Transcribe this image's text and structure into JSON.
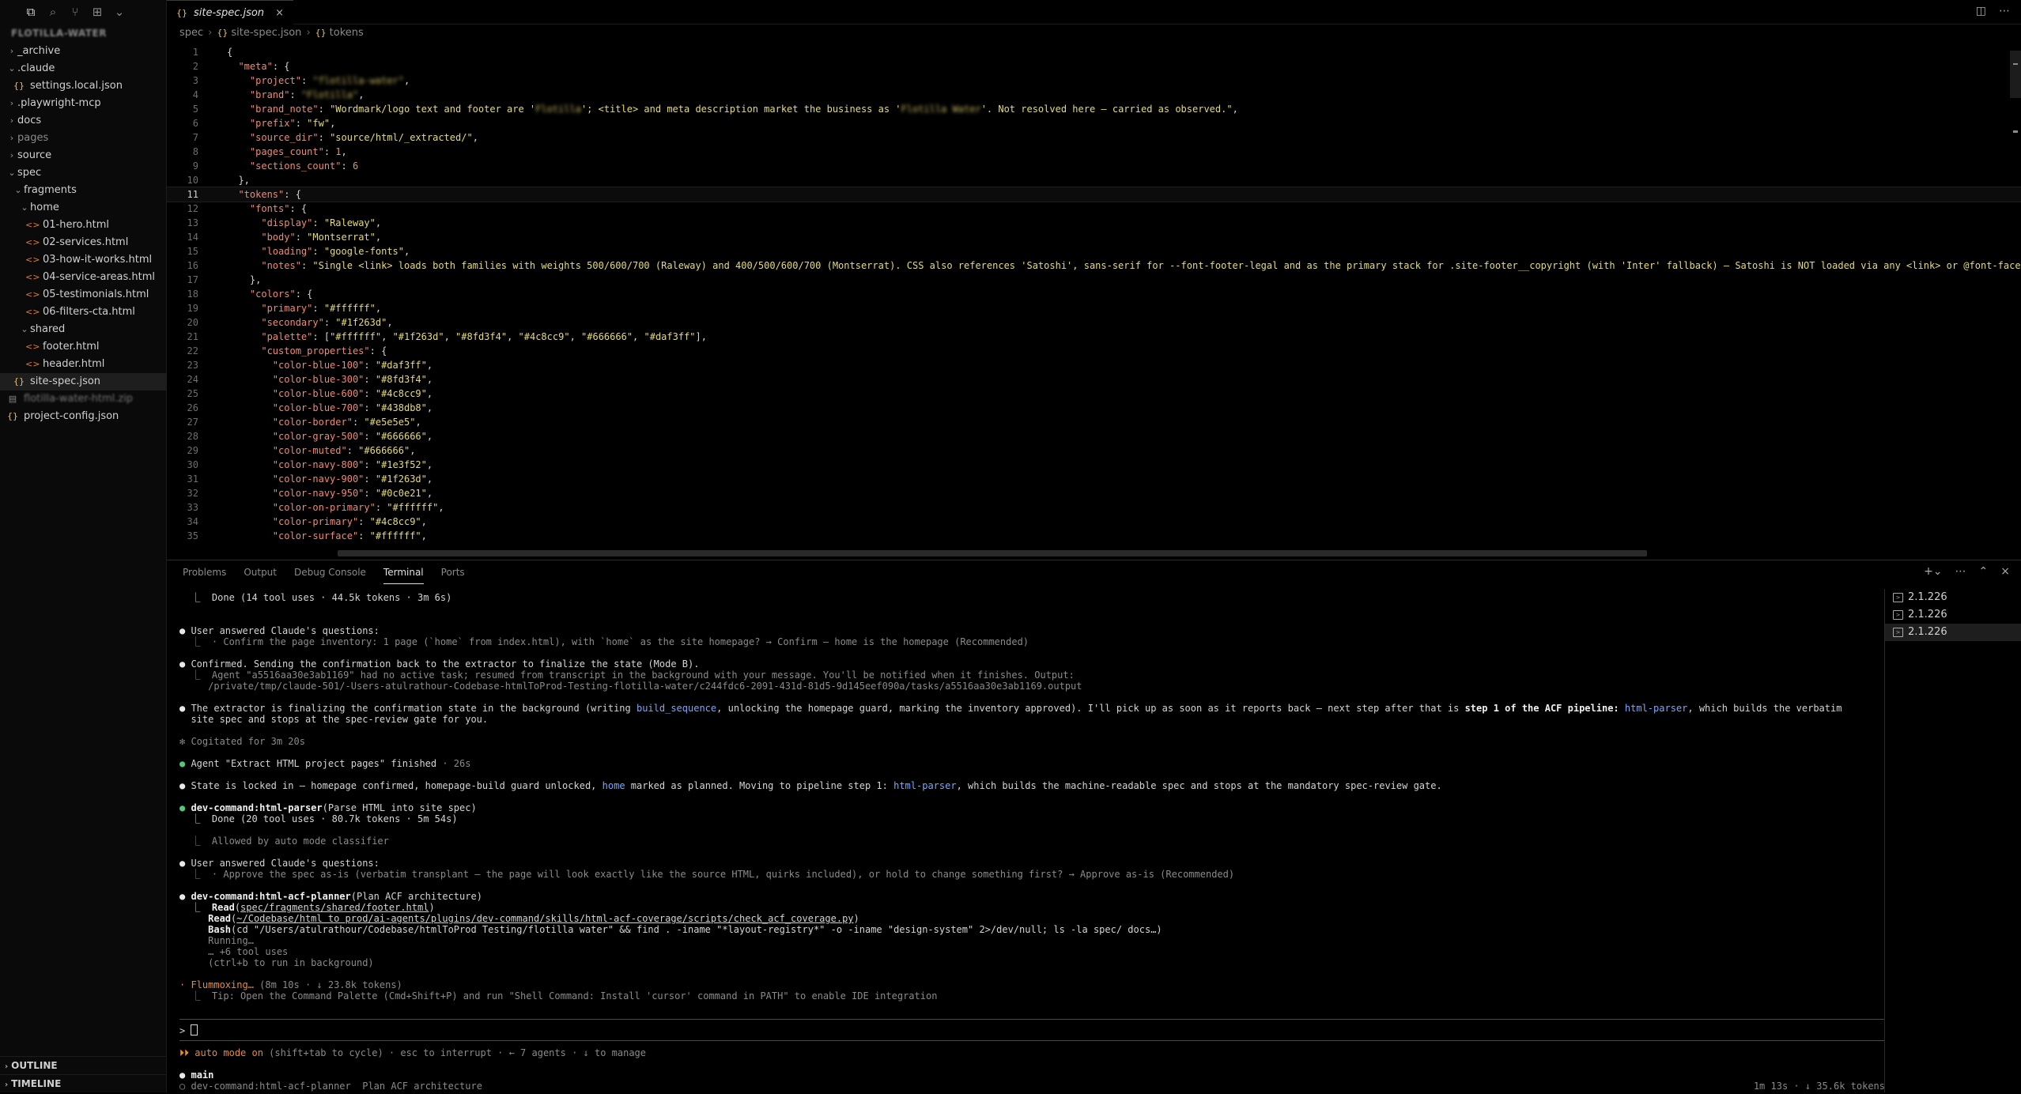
{
  "sidebar": {
    "root_label": "FLOTILLA-WATER",
    "tree": [
      {
        "label": "_archive",
        "type": "folder",
        "expanded": false,
        "depth": 0
      },
      {
        "label": ".claude",
        "type": "folder",
        "expanded": true,
        "depth": 0
      },
      {
        "label": "settings.local.json",
        "type": "json",
        "depth": 1
      },
      {
        "label": ".playwright-mcp",
        "type": "folder",
        "expanded": false,
        "depth": 0
      },
      {
        "label": "docs",
        "type": "folder",
        "expanded": false,
        "depth": 0
      },
      {
        "label": "pages",
        "type": "folder",
        "expanded": false,
        "depth": 0,
        "dim": true
      },
      {
        "label": "source",
        "type": "folder",
        "expanded": false,
        "depth": 0
      },
      {
        "label": "spec",
        "type": "folder",
        "expanded": true,
        "depth": 0
      },
      {
        "label": "fragments",
        "type": "folder",
        "expanded": true,
        "depth": 1
      },
      {
        "label": "home",
        "type": "folder",
        "expanded": true,
        "depth": 2
      },
      {
        "label": "01-hero.html",
        "type": "html",
        "depth": 3
      },
      {
        "label": "02-services.html",
        "type": "html",
        "depth": 3
      },
      {
        "label": "03-how-it-works.html",
        "type": "html",
        "depth": 3
      },
      {
        "label": "04-service-areas.html",
        "type": "html",
        "depth": 3
      },
      {
        "label": "05-testimonials.html",
        "type": "html",
        "depth": 3
      },
      {
        "label": "06-filters-cta.html",
        "type": "html",
        "depth": 3
      },
      {
        "label": "shared",
        "type": "folder",
        "expanded": true,
        "depth": 2
      },
      {
        "label": "footer.html",
        "type": "html",
        "depth": 3
      },
      {
        "label": "header.html",
        "type": "html",
        "depth": 3
      },
      {
        "label": "site-spec.json",
        "type": "json",
        "depth": 1,
        "selected": true
      },
      {
        "label": "flotilla-water-html.zip",
        "type": "zip",
        "depth": 0,
        "blurred": true
      },
      {
        "label": "project-config.json",
        "type": "json",
        "depth": 0
      }
    ],
    "outline_label": "OUTLINE",
    "timeline_label": "TIMELINE"
  },
  "editor": {
    "tab_label": "site-spec.json",
    "breadcrumb": [
      "spec",
      "site-spec.json",
      "tokens"
    ],
    "current_line": 11
  },
  "panel": {
    "tabs": [
      "Problems",
      "Output",
      "Debug Console",
      "Terminal",
      "Ports"
    ],
    "active_tab": "Terminal",
    "terminals": [
      "2.1.226",
      "2.1.226",
      "2.1.226"
    ],
    "input_prompt": ">",
    "mode_arrows": "⏵⏵",
    "mode_label": "auto mode on",
    "mode_hint": " (shift+tab to cycle) · esc to interrupt · ← 7 agents · ↓ to manage",
    "agent_main": "main",
    "agent_sub_name": "dev-command:html-acf-planner",
    "agent_sub_desc": "Plan ACF architecture",
    "status_right": "1m 13s · ↓ 35.6k tokens"
  }
}
